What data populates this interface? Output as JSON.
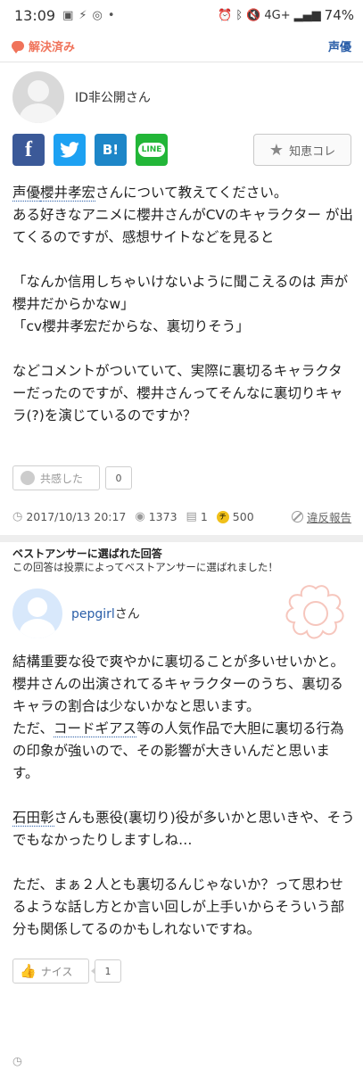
{
  "status_bar": {
    "time": "13:09",
    "network": "4G+",
    "battery": "74%"
  },
  "header": {
    "resolved_label": "解決済み",
    "category_label": "声優"
  },
  "question": {
    "author": "ID非公開さん",
    "chie_label": "知恵コレ",
    "share": {
      "facebook": "f",
      "twitter": "t",
      "hatena": "B!",
      "line": "LINE"
    },
    "lines": [
      "声優櫻井孝宏さんについて教えてください。",
      "ある好きなアニメに櫻井さんがCVのキャラクター が出てくるのですが、感想サイトなどを見ると",
      "",
      "「なんか信用しちゃいけないように聞こえるのは 声が櫻井だからかなw」",
      "「cv櫻井孝宏だからな、裏切りそう」",
      "",
      "などコメントがついていて、実際に裏切るキャラクターだったのですが、櫻井さんってそんなに裏切りキャラ(?)を演じているのですか？"
    ],
    "linked_terms": [
      "声優",
      "櫻井孝宏"
    ],
    "empathy_label": "共感した",
    "empathy_count": "0",
    "date": "2017/10/13 20:17",
    "views": "1373",
    "answers": "1",
    "coins": "500",
    "coin_symbol": "チ",
    "report_label": "違反報告"
  },
  "best_answer": {
    "title": "ベストアンサーに選ばれた回答",
    "subtitle": "この回答は投票によってベストアンサーに選ばれました！",
    "author": "pepgirl",
    "author_suffix": "さん",
    "lines": [
      "結構重要な役で爽やかに裏切ることが多いせいかと。",
      "櫻井さんの出演されてるキャラクターのうち、裏切るキャラの割合は少ないかなと思います。",
      "ただ、コードギアス等の人気作品で大胆に裏切る行為の印象が強いので、その影響が大きいんだと思います。",
      "",
      "石田彰さんも悪役(裏切り)役が多いかと思いきや、そうでもなかったりしますしね…",
      "",
      "ただ、まぁ２人とも裏切るんじゃないか？って思わせるような話し方とか言い回しが上手いからそういう部分も関係してるのかもしれないですね。"
    ],
    "linked_terms": [
      "コードギアス",
      "石田彰"
    ],
    "nice_label": "ナイス",
    "nice_count": "1"
  },
  "colors": {
    "accent_orange": "#f0735a",
    "link_blue": "#2a5ea8",
    "facebook": "#3b5998",
    "twitter": "#1da1f2",
    "hatena": "#1d86c8",
    "line": "#22b638",
    "coin": "#f0c01a"
  }
}
